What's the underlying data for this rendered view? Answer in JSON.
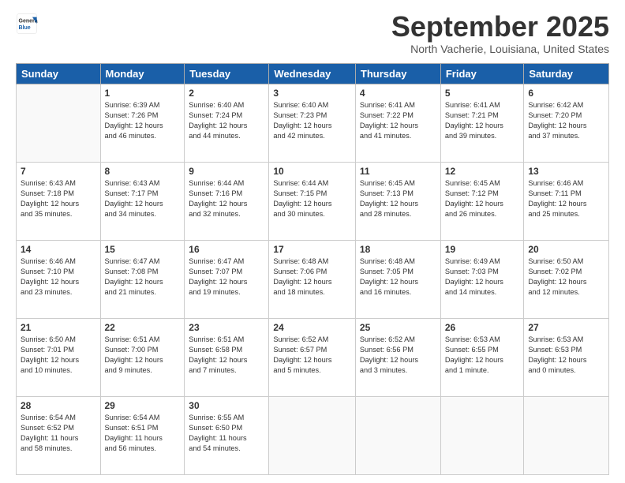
{
  "header": {
    "logo_general": "General",
    "logo_blue": "Blue",
    "month_title": "September 2025",
    "location": "North Vacherie, Louisiana, United States"
  },
  "calendar": {
    "days_of_week": [
      "Sunday",
      "Monday",
      "Tuesday",
      "Wednesday",
      "Thursday",
      "Friday",
      "Saturday"
    ],
    "weeks": [
      [
        {
          "day": "",
          "content": ""
        },
        {
          "day": "1",
          "content": "Sunrise: 6:39 AM\nSunset: 7:26 PM\nDaylight: 12 hours\nand 46 minutes."
        },
        {
          "day": "2",
          "content": "Sunrise: 6:40 AM\nSunset: 7:24 PM\nDaylight: 12 hours\nand 44 minutes."
        },
        {
          "day": "3",
          "content": "Sunrise: 6:40 AM\nSunset: 7:23 PM\nDaylight: 12 hours\nand 42 minutes."
        },
        {
          "day": "4",
          "content": "Sunrise: 6:41 AM\nSunset: 7:22 PM\nDaylight: 12 hours\nand 41 minutes."
        },
        {
          "day": "5",
          "content": "Sunrise: 6:41 AM\nSunset: 7:21 PM\nDaylight: 12 hours\nand 39 minutes."
        },
        {
          "day": "6",
          "content": "Sunrise: 6:42 AM\nSunset: 7:20 PM\nDaylight: 12 hours\nand 37 minutes."
        }
      ],
      [
        {
          "day": "7",
          "content": "Sunrise: 6:43 AM\nSunset: 7:18 PM\nDaylight: 12 hours\nand 35 minutes."
        },
        {
          "day": "8",
          "content": "Sunrise: 6:43 AM\nSunset: 7:17 PM\nDaylight: 12 hours\nand 34 minutes."
        },
        {
          "day": "9",
          "content": "Sunrise: 6:44 AM\nSunset: 7:16 PM\nDaylight: 12 hours\nand 32 minutes."
        },
        {
          "day": "10",
          "content": "Sunrise: 6:44 AM\nSunset: 7:15 PM\nDaylight: 12 hours\nand 30 minutes."
        },
        {
          "day": "11",
          "content": "Sunrise: 6:45 AM\nSunset: 7:13 PM\nDaylight: 12 hours\nand 28 minutes."
        },
        {
          "day": "12",
          "content": "Sunrise: 6:45 AM\nSunset: 7:12 PM\nDaylight: 12 hours\nand 26 minutes."
        },
        {
          "day": "13",
          "content": "Sunrise: 6:46 AM\nSunset: 7:11 PM\nDaylight: 12 hours\nand 25 minutes."
        }
      ],
      [
        {
          "day": "14",
          "content": "Sunrise: 6:46 AM\nSunset: 7:10 PM\nDaylight: 12 hours\nand 23 minutes."
        },
        {
          "day": "15",
          "content": "Sunrise: 6:47 AM\nSunset: 7:08 PM\nDaylight: 12 hours\nand 21 minutes."
        },
        {
          "day": "16",
          "content": "Sunrise: 6:47 AM\nSunset: 7:07 PM\nDaylight: 12 hours\nand 19 minutes."
        },
        {
          "day": "17",
          "content": "Sunrise: 6:48 AM\nSunset: 7:06 PM\nDaylight: 12 hours\nand 18 minutes."
        },
        {
          "day": "18",
          "content": "Sunrise: 6:48 AM\nSunset: 7:05 PM\nDaylight: 12 hours\nand 16 minutes."
        },
        {
          "day": "19",
          "content": "Sunrise: 6:49 AM\nSunset: 7:03 PM\nDaylight: 12 hours\nand 14 minutes."
        },
        {
          "day": "20",
          "content": "Sunrise: 6:50 AM\nSunset: 7:02 PM\nDaylight: 12 hours\nand 12 minutes."
        }
      ],
      [
        {
          "day": "21",
          "content": "Sunrise: 6:50 AM\nSunset: 7:01 PM\nDaylight: 12 hours\nand 10 minutes."
        },
        {
          "day": "22",
          "content": "Sunrise: 6:51 AM\nSunset: 7:00 PM\nDaylight: 12 hours\nand 9 minutes."
        },
        {
          "day": "23",
          "content": "Sunrise: 6:51 AM\nSunset: 6:58 PM\nDaylight: 12 hours\nand 7 minutes."
        },
        {
          "day": "24",
          "content": "Sunrise: 6:52 AM\nSunset: 6:57 PM\nDaylight: 12 hours\nand 5 minutes."
        },
        {
          "day": "25",
          "content": "Sunrise: 6:52 AM\nSunset: 6:56 PM\nDaylight: 12 hours\nand 3 minutes."
        },
        {
          "day": "26",
          "content": "Sunrise: 6:53 AM\nSunset: 6:55 PM\nDaylight: 12 hours\nand 1 minute."
        },
        {
          "day": "27",
          "content": "Sunrise: 6:53 AM\nSunset: 6:53 PM\nDaylight: 12 hours\nand 0 minutes."
        }
      ],
      [
        {
          "day": "28",
          "content": "Sunrise: 6:54 AM\nSunset: 6:52 PM\nDaylight: 11 hours\nand 58 minutes."
        },
        {
          "day": "29",
          "content": "Sunrise: 6:54 AM\nSunset: 6:51 PM\nDaylight: 11 hours\nand 56 minutes."
        },
        {
          "day": "30",
          "content": "Sunrise: 6:55 AM\nSunset: 6:50 PM\nDaylight: 11 hours\nand 54 minutes."
        },
        {
          "day": "",
          "content": ""
        },
        {
          "day": "",
          "content": ""
        },
        {
          "day": "",
          "content": ""
        },
        {
          "day": "",
          "content": ""
        }
      ]
    ]
  }
}
